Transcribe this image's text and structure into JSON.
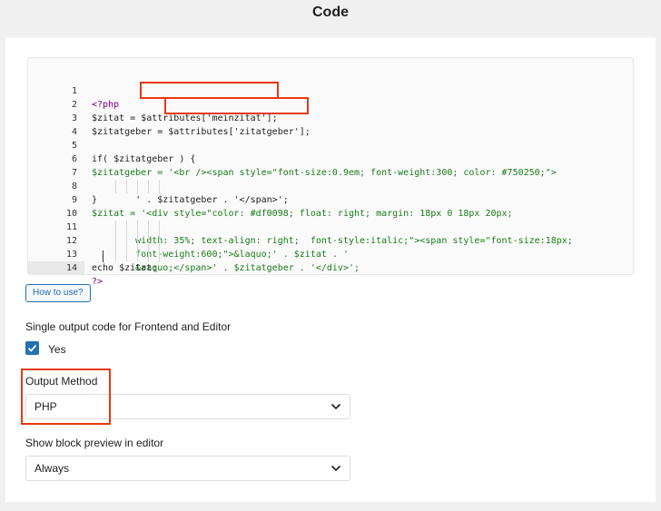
{
  "header": {
    "title": "Code"
  },
  "code_lines": [
    {
      "num": "1",
      "text": "<?php"
    },
    {
      "num": "2",
      "text": "$zitat = $attributes['meinzitat'];"
    },
    {
      "num": "3",
      "text": "$zitatgeber = $attributes['zitatgeber'];"
    },
    {
      "num": "4",
      "text": ""
    },
    {
      "num": "5",
      "text": "if( $zitatgeber ) {"
    },
    {
      "num": "6",
      "text": "$zitatgeber = '<br /><span style=\"font-size:0.9em; font-weight:300; color: #750250;\">"
    },
    {
      "num": "7",
      "text": "        ' . $zitatgeber . '</span>';"
    },
    {
      "num": "8",
      "text": "}"
    },
    {
      "num": "9",
      "text": "$zitat = '<div style=\"color: #df0098; float: right; margin: 18px 0 18px 20px;"
    },
    {
      "num": "10",
      "text": "        width: 35%; text-align: right;  font-style:italic;\"><span style=\"font-size:18px;"
    },
    {
      "num": "11",
      "text": "        font-weight:600;\">&laquo;' . $zitat . '"
    },
    {
      "num": "12",
      "text": "        &raquo;</span>' . $zitatgeber . '</div>';"
    },
    {
      "num": "13",
      "text": "echo $zitat;"
    },
    {
      "num": "14",
      "text": "?>"
    }
  ],
  "how_to_button": "How to use?",
  "single_output": {
    "label": "Single output code for Frontend and Editor",
    "checkbox_label": "Yes",
    "checked": true
  },
  "output_method": {
    "label": "Output Method",
    "value": "PHP"
  },
  "block_preview": {
    "label": "Show block preview in editor",
    "value": "Always"
  },
  "colors": {
    "accent": "#2271b1",
    "highlight": "#e8380d",
    "keyword": "#770088",
    "string": "#1a7a1a"
  },
  "icons": {
    "checkbox": "check-icon",
    "select": "chevron-down-icon"
  }
}
